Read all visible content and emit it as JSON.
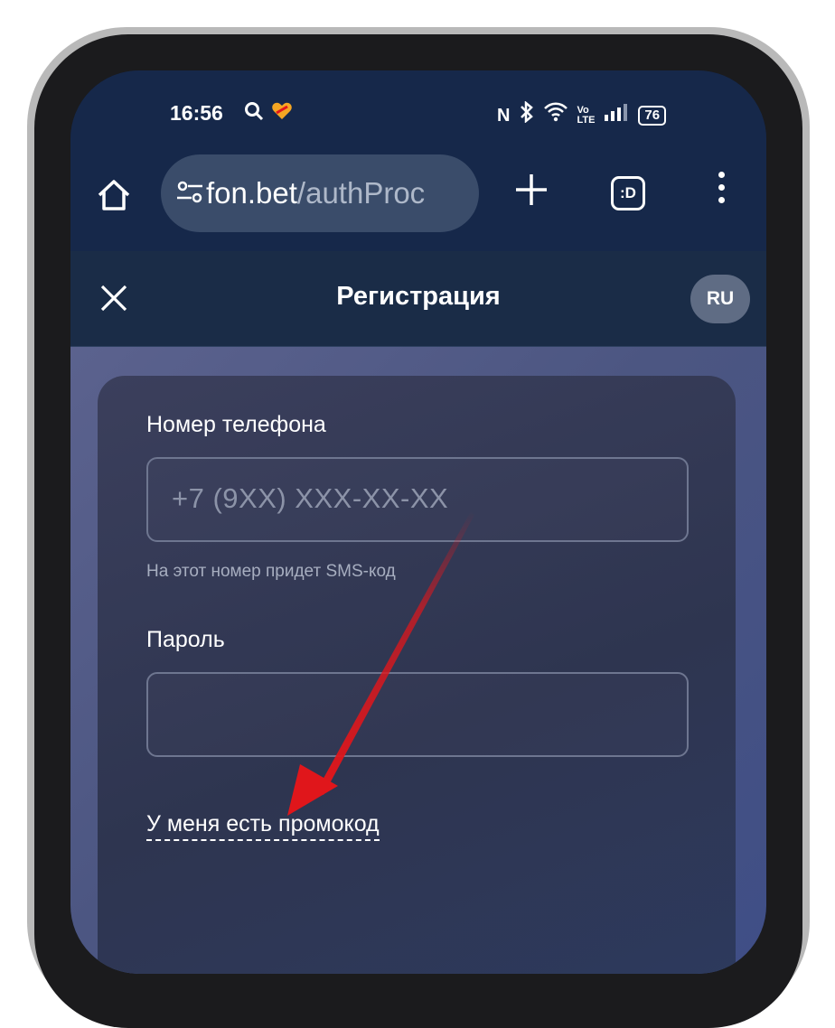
{
  "status_bar": {
    "time": "16:56",
    "battery": "76"
  },
  "browser": {
    "url_domain": "fon.bet",
    "url_path": "/authProc",
    "tabs_label": ":D"
  },
  "header": {
    "title": "Регистрация",
    "language": "RU"
  },
  "form": {
    "phone_label": "Номер телефона",
    "phone_placeholder": "+7 (9XX) XXX-XX-XX",
    "phone_hint": "На этот номер придет SMS-код",
    "password_label": "Пароль",
    "password_value": "",
    "promo_link": "У меня есть промокод"
  },
  "colors": {
    "app_bar": "#16284a",
    "annotation_arrow": "#e0161b"
  }
}
